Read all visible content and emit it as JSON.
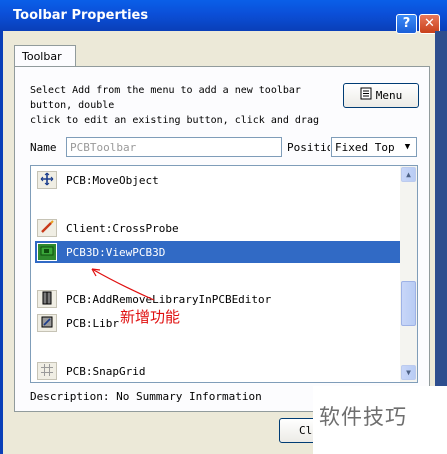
{
  "window": {
    "title": "Toolbar Properties",
    "help_label": "?",
    "close_label": "✕"
  },
  "tab": {
    "label": "Toolbar"
  },
  "instructions": {
    "line1": "Select Add from the menu to add a new toolbar",
    "line2": "button, double",
    "line3": "click to edit an existing button, click and drag"
  },
  "menu_button": {
    "label": "Menu",
    "icon": "menu-icon"
  },
  "name_field": {
    "label": "Name",
    "value": "PCBToolbar"
  },
  "position_field": {
    "label": "Position",
    "value": "Fixed Top"
  },
  "list": {
    "items": [
      {
        "label": "PCB:MoveObject",
        "icon": "move-cross-icon",
        "selected": false
      },
      {
        "label": "Client:CrossProbe",
        "icon": "crossprobe-pen-icon",
        "selected": false
      },
      {
        "label": "PCB3D:ViewPCB3D",
        "icon": "pcb3d-view-icon",
        "selected": true
      },
      {
        "label": "PCB:AddRemoveLibraryInPCBEditor",
        "icon": "library-book-icon",
        "selected": false
      },
      {
        "label": "PCB:Libr",
        "icon": "library-tool-icon",
        "selected": false
      },
      {
        "label": "PCB:SnapGrid",
        "icon": "grid-icon",
        "selected": false
      }
    ]
  },
  "description": {
    "text": "Description: No Summary Information"
  },
  "close_button": {
    "label": "Cl"
  },
  "annotation": {
    "text": "新增功能",
    "color": "#E01010"
  },
  "watermark": {
    "text": "软件技巧"
  },
  "colors": {
    "selection": "#316AC5",
    "titlebar": "#0B4FD8"
  }
}
